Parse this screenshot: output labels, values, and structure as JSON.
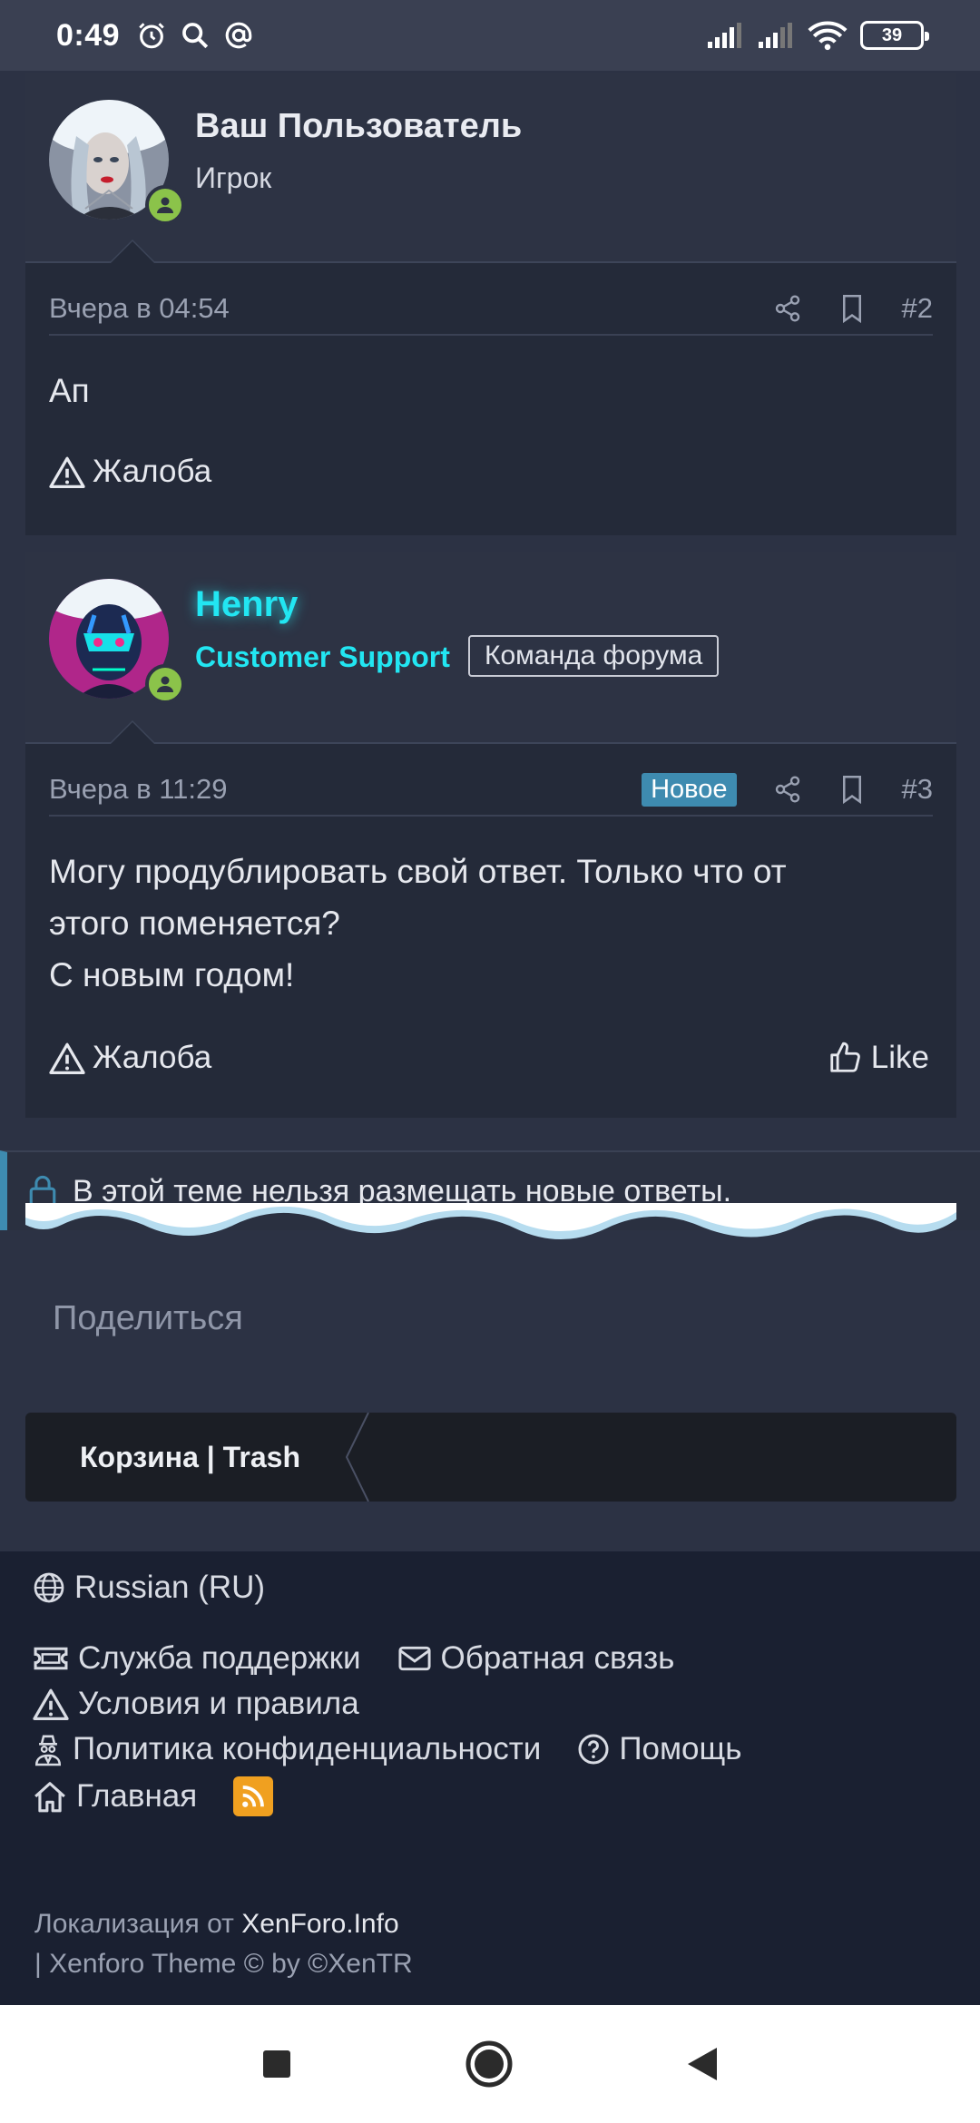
{
  "status_bar": {
    "time": "0:49",
    "battery": "39"
  },
  "posts": [
    {
      "author": "Ваш Пользователь",
      "user_title": "Игрок",
      "date": "Вчера в 04:54",
      "number": "#2",
      "body": [
        "Ап"
      ],
      "report_label": "Жалоба"
    },
    {
      "author": "Henry",
      "role": "Customer Support",
      "team_badge": "Команда форума",
      "date": "Вчера в 11:29",
      "new_badge": "Новое",
      "number": "#3",
      "body": [
        "Могу продублировать свой ответ. Только что от",
        "этого поменяется?",
        "С новым годом!"
      ],
      "report_label": "Жалоба",
      "like_label": "Like"
    }
  ],
  "locked_notice": "В этой теме нельзя размещать новые ответы.",
  "share_label": "Поделиться",
  "breadcrumb": {
    "label": "Корзина | Trash"
  },
  "footer": {
    "language": "Russian (RU)",
    "links": {
      "support": "Служба поддержки",
      "feedback": "Обратная связь",
      "terms": "Условия и правила",
      "privacy": "Политика конфиденциальности",
      "help": "Помощь",
      "home": "Главная"
    },
    "localization_prefix": "Локализация от",
    "localization_link": "XenForo.Info",
    "theme_credit": "| Xenforo Theme © by ©XenTR"
  },
  "colors": {
    "accent": "#3e8bb0",
    "henry": "#22e6f2",
    "online": "#8bc34a",
    "rss": "#f0a020"
  }
}
